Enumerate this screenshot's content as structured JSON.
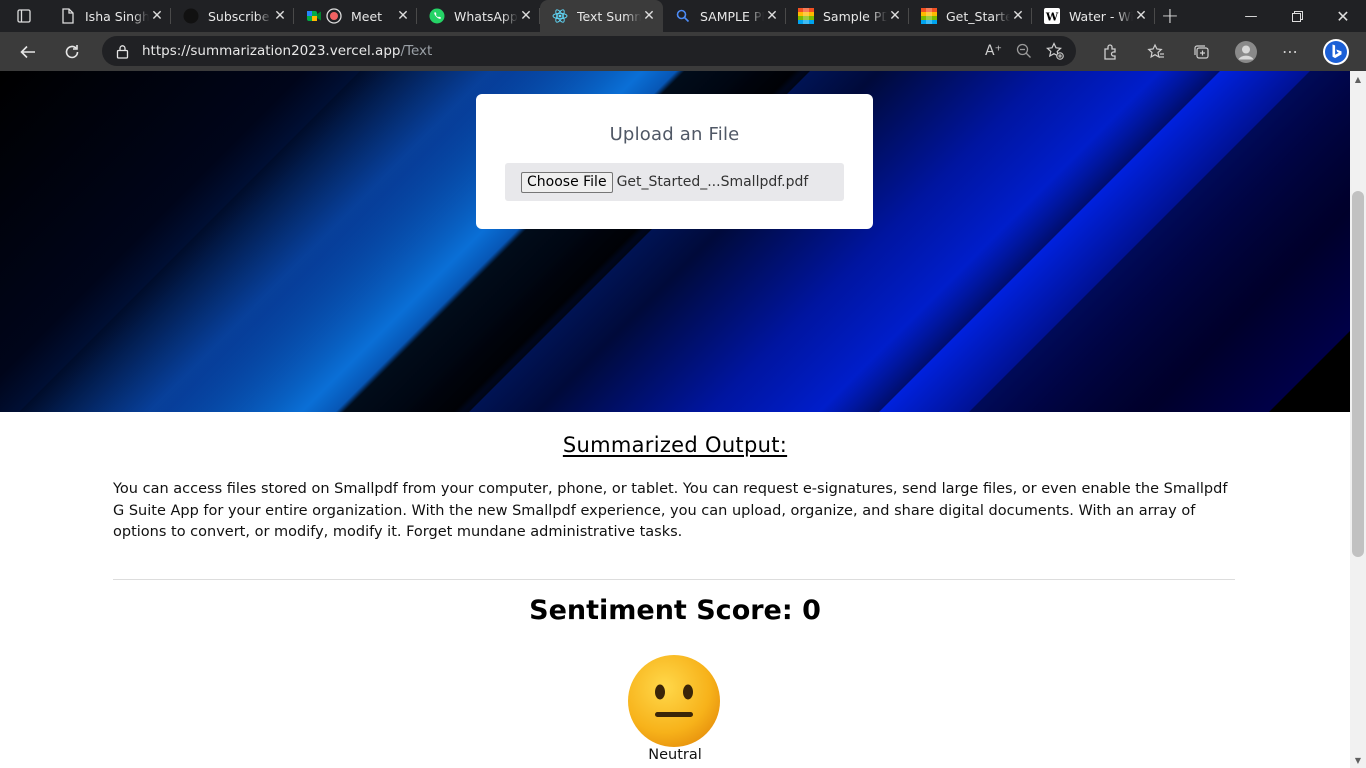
{
  "browser": {
    "tabs": [
      {
        "title": "Isha Singh",
        "icon": "document-icon"
      },
      {
        "title": "Subscribe - ",
        "icon": "github-icon"
      },
      {
        "title": "Meet",
        "icon": "meet-icon"
      },
      {
        "title": "WhatsApp",
        "icon": "whatsapp-icon"
      },
      {
        "title": "Text Summ",
        "icon": "react-icon"
      },
      {
        "title": "SAMPLE PD",
        "icon": "search-icon"
      },
      {
        "title": "Sample PD",
        "icon": "microsoft-icon"
      },
      {
        "title": "Get_Starte",
        "icon": "microsoft-icon"
      },
      {
        "title": "Water - Wi",
        "icon": "wikipedia-icon"
      }
    ],
    "active_tab_index": 4,
    "url_host": "https://summarization2023.vercel.app",
    "url_path": "/Text"
  },
  "upload": {
    "title": "Upload an File",
    "button_label": "Choose File",
    "file_name": "Get_Started_...Smallpdf.pdf"
  },
  "summary": {
    "heading": "Summarized Output:",
    "text": "You can access files stored on Smallpdf from your computer, phone, or tablet. You can request e-signatures, send large files, or even enable the Smallpdf G Suite App for your entire organization. With the new Smallpdf experience, you can upload, organize, and share digital documents. With an array of options to convert, or modify, modify it. Forget mundane administrative tasks."
  },
  "sentiment": {
    "label": "Sentiment Score: 0",
    "emoji_label": "Neutral",
    "emoji": "neutral-face-icon"
  },
  "colors": {
    "tabbar": "#202124",
    "toolbar": "#3b3b3b",
    "hero_blue": "#0022e0"
  }
}
